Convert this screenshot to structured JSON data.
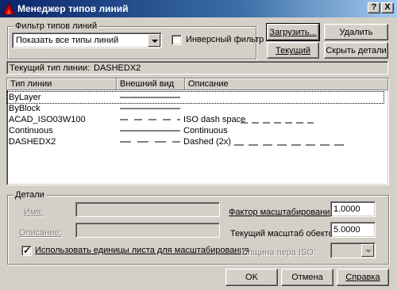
{
  "window": {
    "title": "Менеджер типов линий",
    "help_button": "?",
    "close_button": "X"
  },
  "filter": {
    "group_label": "Фильтр типов линий",
    "selected": "Показать все типы линий",
    "invert_label": "Инверсный фильтр",
    "invert_checked": false
  },
  "buttons": {
    "load": "Загрузить...",
    "delete": "Удалить",
    "current": "Текущий",
    "hide_details": "Скрыть детали",
    "ok": "OK",
    "cancel": "Отмена",
    "help": "Справка"
  },
  "current_linetype": {
    "label": "Текущий тип линии:",
    "value": "DASHEDX2"
  },
  "table": {
    "headers": [
      "Тип линии",
      "Внешний вид",
      "Описание"
    ],
    "rows": [
      {
        "name": "ByLayer",
        "pattern": "solid",
        "description": ""
      },
      {
        "name": "ByBlock",
        "pattern": "solid",
        "description": ""
      },
      {
        "name": "ACAD_ISO03W100",
        "pattern": "dash-space",
        "description": "ISO dash space"
      },
      {
        "name": "Continuous",
        "pattern": "solid",
        "description": "Continuous"
      },
      {
        "name": "DASHEDX2",
        "pattern": "dashed",
        "description": "Dashed (2x)"
      }
    ]
  },
  "details": {
    "group_label": "Детали",
    "name_label": "Имя:",
    "description_label": "Описание:",
    "use_paper_units_label": "Использовать единицы листа для масштабирования",
    "use_paper_units_checked": true,
    "global_scale_label": "Фактор масштабирования:",
    "global_scale_value": "1.0000",
    "current_scale_label": "Текущий масштаб обектов:",
    "current_scale_value": "5.0000",
    "iso_pen_label": "Толщина пера ISO:"
  }
}
